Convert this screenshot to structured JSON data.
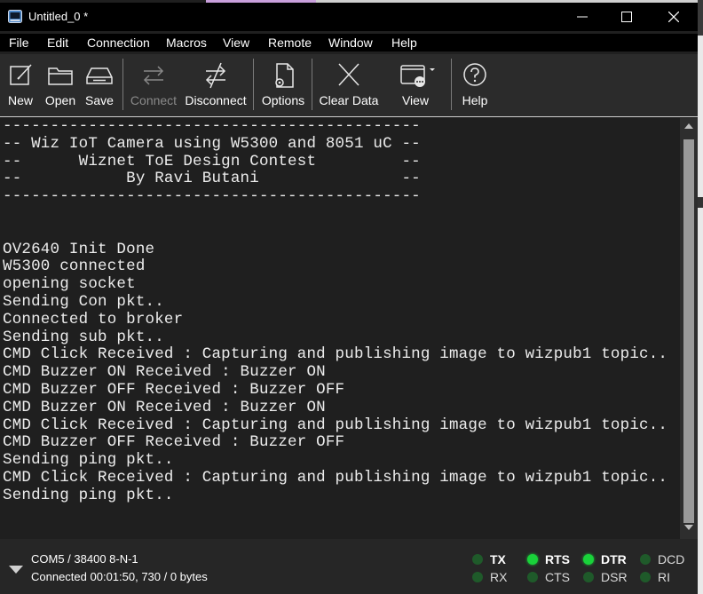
{
  "window": {
    "title": "Untitled_0 *"
  },
  "menu": [
    "File",
    "Edit",
    "Connection",
    "Macros",
    "View",
    "Remote",
    "Window",
    "Help"
  ],
  "toolbar": {
    "new": "New",
    "open": "Open",
    "save": "Save",
    "connect": "Connect",
    "disconnect": "Disconnect",
    "options": "Options",
    "clear": "Clear Data",
    "view": "View",
    "help": "Help"
  },
  "terminal": {
    "lines": [
      "--------------------------------------------",
      "-- Wiz IoT Camera using W5300 and 8051 uC --",
      "--      Wiznet ToE Design Contest         --",
      "--           By Ravi Butani               --",
      "--------------------------------------------",
      "",
      "",
      "OV2640 Init Done",
      "W5300 connected",
      "opening socket",
      "Sending Con pkt..",
      "Connected to broker",
      "Sending sub pkt..",
      "CMD Click Received : Capturing and publishing image to wizpub1 topic..",
      "CMD Buzzer ON Received : Buzzer ON",
      "CMD Buzzer OFF Received : Buzzer OFF",
      "CMD Buzzer ON Received : Buzzer ON",
      "CMD Click Received : Capturing and publishing image to wizpub1 topic..",
      "CMD Buzzer OFF Received : Buzzer OFF",
      "Sending ping pkt..",
      "CMD Click Received : Capturing and publishing image to wizpub1 topic..",
      "Sending ping pkt.."
    ]
  },
  "status": {
    "port": "COM5 / 38400 8-N-1",
    "connection": "Connected 00:01:50, 730 / 0 bytes",
    "signals": {
      "tx": "TX",
      "rx": "RX",
      "rts": "RTS",
      "cts": "CTS",
      "dtr": "DTR",
      "dsr": "DSR",
      "dcd": "DCD",
      "ri": "RI"
    }
  },
  "colors": {
    "led_on": "#19d23a",
    "led_off": "#1f5a2a",
    "background": "#2b2b2b"
  }
}
